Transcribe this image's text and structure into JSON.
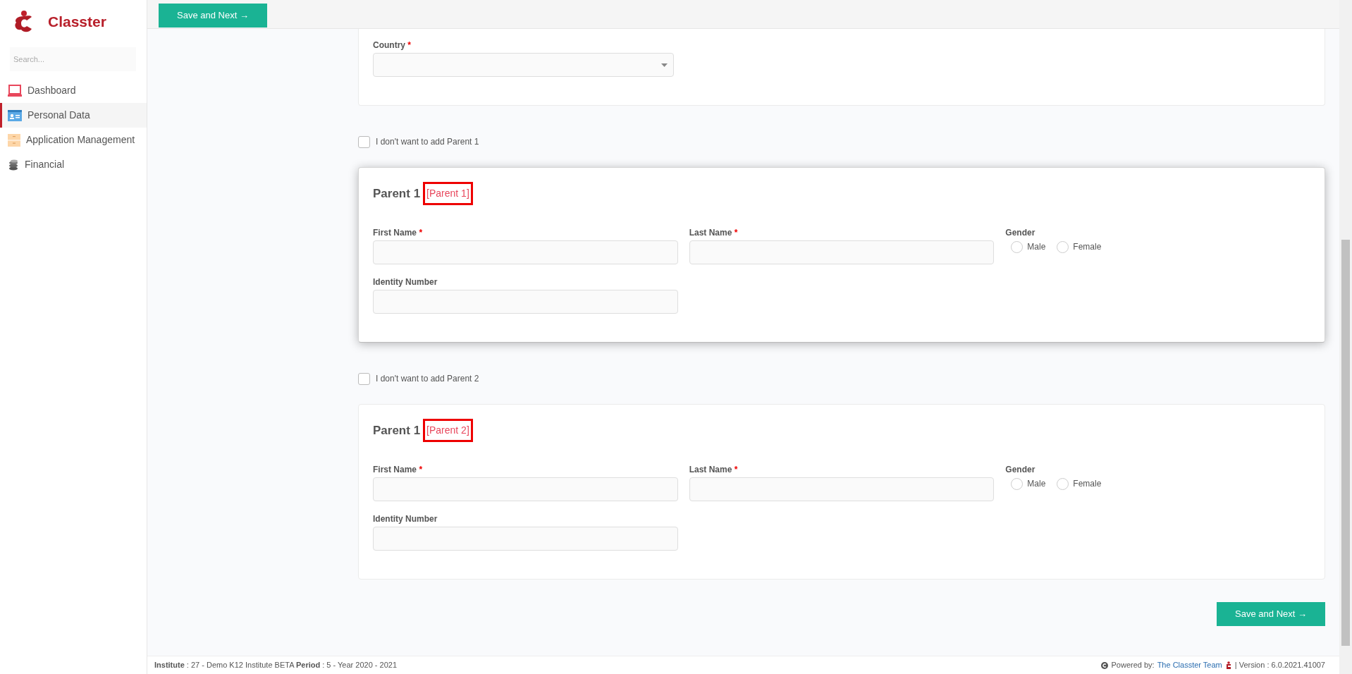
{
  "sidebar": {
    "brand": "Classter",
    "search": {
      "placeholder": "Search..."
    },
    "items": [
      {
        "label": "Dashboard",
        "selected": false
      },
      {
        "label": "Personal Data",
        "selected": true
      },
      {
        "label": "Application Management",
        "selected": false
      },
      {
        "label": "Financial",
        "selected": false
      }
    ]
  },
  "top_button": "Save and Next →",
  "country": {
    "label": "Country",
    "required_mark": "*"
  },
  "sections": [
    {
      "skip_label": "I don't want to add Parent 1",
      "skip_checked": false,
      "title": "Parent 1",
      "tag": "[Parent 1]",
      "tag_outlined": true,
      "raised": true,
      "fields": [
        {
          "kind": "text",
          "label": "First Name",
          "required_mark": "*"
        },
        {
          "kind": "text",
          "label": "Last Name",
          "required_mark": "*"
        },
        {
          "kind": "radio",
          "label": "Gender",
          "options": [
            {
              "label": "Male",
              "selected": false
            },
            {
              "label": "Female",
              "selected": false
            }
          ]
        },
        {
          "kind": "text",
          "label": "Identity Number"
        }
      ]
    },
    {
      "skip_label": "I don't want to add Parent 2",
      "skip_checked": false,
      "title": "Parent 1",
      "tag": "[Parent 2]",
      "tag_outlined": true,
      "raised": false,
      "fields": [
        {
          "kind": "text",
          "label": "First Name",
          "required_mark": "*"
        },
        {
          "kind": "text",
          "label": "Last Name",
          "required_mark": "*"
        },
        {
          "kind": "radio",
          "label": "Gender",
          "options": [
            {
              "label": "Male",
              "selected": false
            },
            {
              "label": "Female",
              "selected": false
            }
          ]
        },
        {
          "kind": "text",
          "label": "Identity Number"
        }
      ]
    }
  ],
  "bottom_button": "Save and Next →",
  "footer": {
    "institute_label": "Institute",
    "institute": ": 27 - Demo K12 Institute BETA",
    "period_label": "Period",
    "period": ": 5 - Year 2020 - 2021",
    "powered": "Powered by:",
    "team": "The Classter Team",
    "version": "| Version : 6.0.2021.41007"
  }
}
